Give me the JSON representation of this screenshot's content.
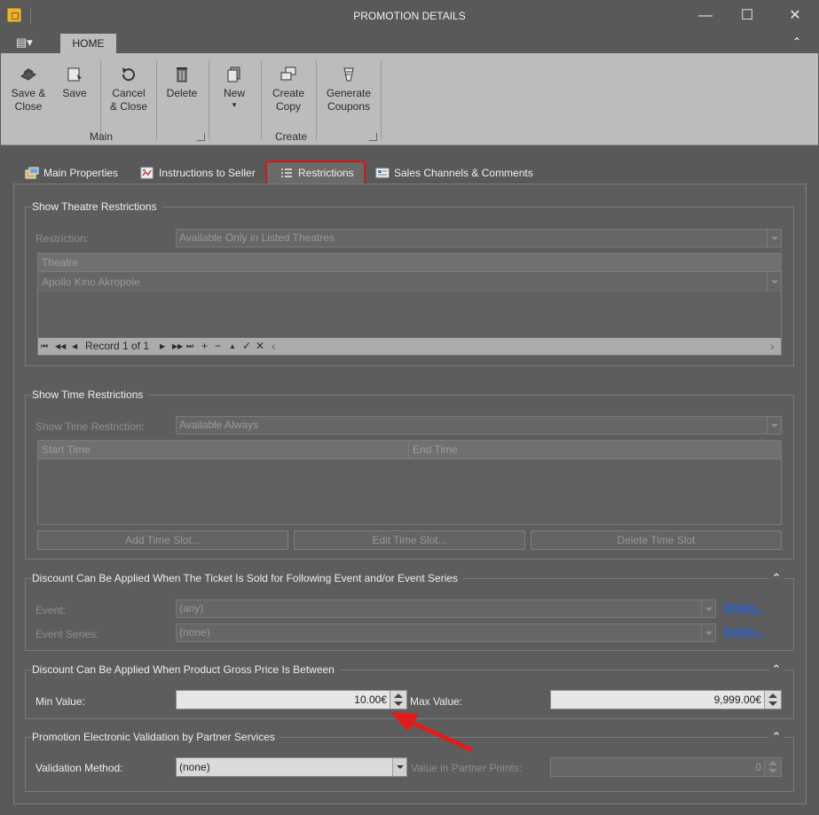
{
  "window": {
    "title": "PROMOTION DETAILS",
    "minimize_glyph": "—",
    "maximize_glyph": "☐",
    "close_glyph": "✕"
  },
  "ribbon": {
    "app_menu_glyph": "▤▾",
    "tab_home": "HOME",
    "collapse_glyph": "⌃",
    "buttons": {
      "save_close": "Save &\nClose",
      "save": "Save",
      "cancel_close": "Cancel\n& Close",
      "delete": "Delete",
      "new": "New",
      "new_arrow": "▾",
      "create_copy": "Create\nCopy",
      "generate_coupons": "Generate\nCoupons"
    },
    "groups": {
      "main": "Main",
      "create": "Create"
    }
  },
  "tabs": {
    "main_properties": "Main Properties",
    "instructions_to_seller": "Instructions to Seller",
    "restrictions": "Restrictions",
    "sales_channels_comments": "Sales Channels & Comments"
  },
  "theatre": {
    "title": "Show Theatre Restrictions",
    "restriction_label": "Restriction:",
    "restriction_value": "Available Only in Listed Theatres",
    "grid_header": "Theatre",
    "rows": [
      "Apollo Kino Akropole"
    ],
    "navigator": {
      "record_text": "Record 1 of 1",
      "first": "⏮",
      "prev_page": "◀◀",
      "prev": "◀",
      "next": "▶",
      "next_page": "▶▶",
      "last": "⏭",
      "add": "+",
      "remove": "−",
      "up": "▲",
      "ok": "✓",
      "cancel": "✕",
      "scroll_left": "‹",
      "scroll_right": "›"
    }
  },
  "time": {
    "title": "Show Time Restrictions",
    "restriction_label": "Show Time Restriction:",
    "restriction_value": "Available Always",
    "col_start": "Start Time",
    "col_end": "End Time",
    "add_btn": "Add Time Slot...",
    "edit_btn": "Edit Time Slot...",
    "delete_btn": "Delete Time Slot"
  },
  "event": {
    "title": "Discount Can Be Applied When The Ticket Is Sold for Following Event and/or Event Series",
    "event_label": "Event:",
    "event_value": "(any)",
    "series_label": "Event Series:",
    "series_value": "(none)",
    "details_link": "Details...",
    "collapse_glyph": "⌃"
  },
  "price": {
    "title": "Discount Can Be Applied When Product Gross Price Is Between",
    "min_label": "Min Value:",
    "min_value": "10.00€",
    "max_label": "Max Value:",
    "max_value": "9,999.00€",
    "collapse_glyph": "⌃"
  },
  "validation": {
    "title": "Promotion Electronic Validation by Partner Services",
    "method_label": "Validation Method:",
    "method_value": "(none)",
    "points_label": "Value in Partner Points:",
    "points_value": "0",
    "collapse_glyph": "⌃"
  },
  "colors": {
    "highlight_red": "#d01818",
    "link_blue": "#1060ff",
    "ribbon_bg": "#bcbcbc",
    "window_bg": "#595959"
  },
  "icons": [
    "app-icon",
    "save-close-icon",
    "save-icon",
    "cancel-close-icon",
    "delete-icon",
    "new-icon",
    "create-copy-icon",
    "generate-coupons-icon",
    "main-properties-icon",
    "instructions-icon",
    "restrictions-icon",
    "sales-channels-icon",
    "arrow-annotation"
  ]
}
